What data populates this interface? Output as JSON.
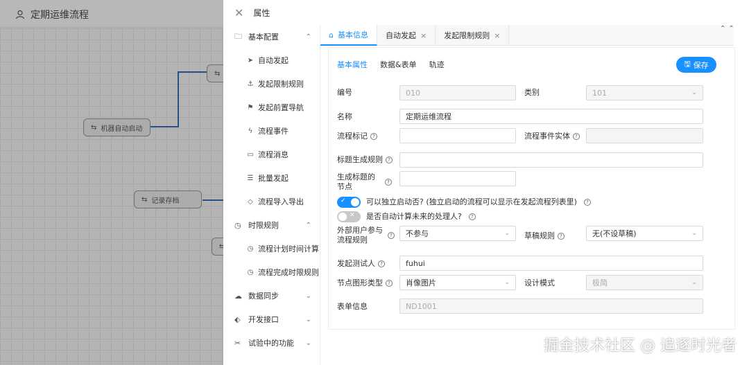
{
  "canvas": {
    "title": "定期运维流程",
    "nodes": [
      {
        "label": "机器自动启动"
      },
      {
        "label": "记录存档"
      }
    ]
  },
  "drawer": {
    "title": "属性",
    "menu": {
      "group1": {
        "label": "基本配置",
        "items": [
          "自动发起",
          "发起限制规则",
          "发起前置导航",
          "流程事件",
          "流程消息",
          "批量发起",
          "流程导入导出"
        ]
      },
      "group2": {
        "label": "时限规则",
        "items": [
          "流程计划时间计算",
          "流程完成时限规则"
        ]
      },
      "group3": {
        "label": "数据同步"
      },
      "group4": {
        "label": "开发接口"
      },
      "group5": {
        "label": "试验中的功能"
      }
    },
    "tabs": [
      "基本信息",
      "自动发起",
      "发起限制规则"
    ],
    "subtabs": [
      "基本属性",
      "数据&表单",
      "轨迹"
    ],
    "save_label": "保存",
    "form": {
      "number": {
        "label": "编号",
        "value": "010"
      },
      "category": {
        "label": "类别",
        "value": "101"
      },
      "name": {
        "label": "名称",
        "value": "定期运维流程"
      },
      "flow_mark": {
        "label": "流程标记",
        "value": ""
      },
      "event_entity": {
        "label": "流程事件实体",
        "value": ""
      },
      "title_rule": {
        "label": "标题生成规则",
        "value": ""
      },
      "title_node": {
        "label": "生成标题的节点",
        "value": ""
      },
      "independent_start": {
        "label": "可以独立启动否? (独立启动的流程可以显示在发起流程列表里)",
        "on": true
      },
      "auto_calc": {
        "label": "是否自动计算未来的处理人?",
        "on": false
      },
      "external_users": {
        "label": "外部用户参与流程规则",
        "value": "不参与"
      },
      "draft_rule": {
        "label": "草稿规则",
        "value": "无(不设草稿)"
      },
      "test_person": {
        "label": "发起测试人",
        "value": "fuhui"
      },
      "node_shape": {
        "label": "节点图形类型",
        "value": "肖像图片"
      },
      "design_mode": {
        "label": "设计模式",
        "value": "极简"
      },
      "form_info": {
        "label": "表单信息",
        "value": "ND1001"
      }
    }
  },
  "watermark": "掘金技术社区 @ 追逐时光者"
}
